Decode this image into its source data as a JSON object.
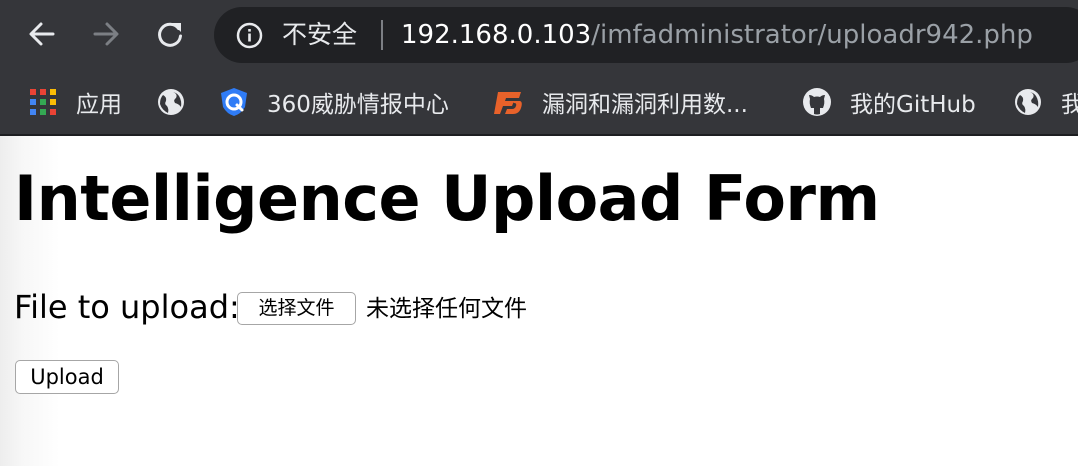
{
  "browser": {
    "security_label": "不安全",
    "url_host": "192.168.0.103",
    "url_path": "/imfadministrator/uploadr942.php"
  },
  "bookmarks": {
    "apps_label": "应用",
    "item_360_label": "360威胁情报中心",
    "vuln_label": "漏洞和漏洞利用数...",
    "github_label": "我的GitHub",
    "last_label": "我"
  },
  "page": {
    "title": "Intelligence Upload Form",
    "file_label": "File to upload:",
    "choose_file_button": "选择文件",
    "no_file_text": "未选择任何文件",
    "upload_button": "Upload"
  },
  "colors": {
    "chrome_background": "#35363a",
    "omnibox_background": "#202124",
    "url_path_color": "#9aa0a6"
  }
}
